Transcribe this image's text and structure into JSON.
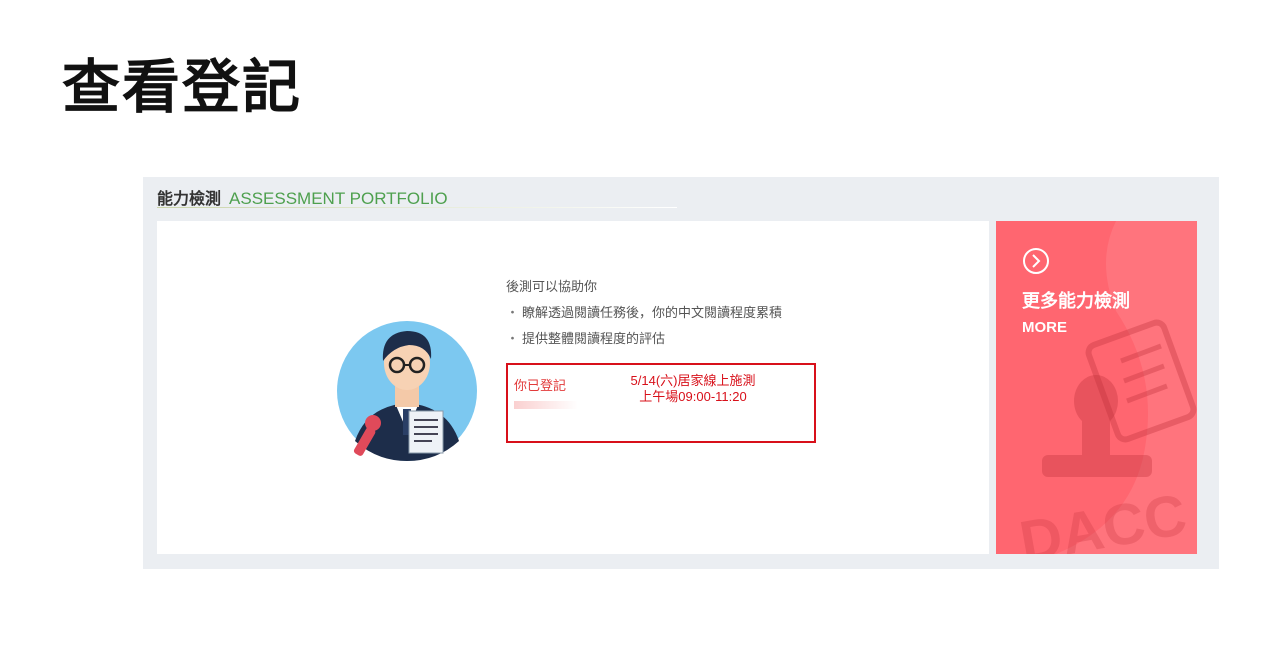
{
  "slide": {
    "title": "查看登記"
  },
  "section": {
    "title_zh": "能力檢測",
    "title_en": "ASSESSMENT PORTFOLIO"
  },
  "main_card": {
    "intro": "後測可以協助你",
    "bullets": [
      "瞭解透過閱讀任務後，你的中文閱讀程度累積",
      "提供整體閱讀程度的評估"
    ],
    "registration": {
      "label": "你已登記",
      "line1": "5/14(六)居家線上施測",
      "line2": "上午場09:00-11:20"
    }
  },
  "side_card": {
    "title": "更多能力檢測",
    "more_label": "MORE"
  },
  "colors": {
    "panel_bg": "#ebeef2",
    "accent_green": "#4ea04e",
    "highlight_red": "#d8101a",
    "side_card_bg": "#ff6670"
  },
  "icons": {
    "arrow": "chevron-right-circle-icon",
    "avatar": "teacher-avatar-icon",
    "stamp": "stamp-icon",
    "clipboard": "clipboard-icon"
  }
}
